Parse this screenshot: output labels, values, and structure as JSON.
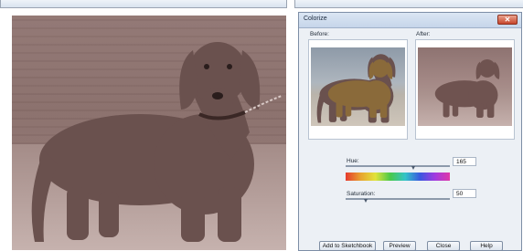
{
  "dialog": {
    "title": "Colorize",
    "close_symbol": "✕",
    "before_label": "Before:",
    "after_label": "After:",
    "hue": {
      "label": "Hue:",
      "value": "165",
      "level": 0.65
    },
    "saturation": {
      "label": "Saturation:",
      "value": "50",
      "level": 0.2
    },
    "buttons": {
      "add_to_sketchbook": "Add to Sketchbook",
      "preview": "Preview",
      "close": "Close",
      "help": "Help"
    }
  },
  "colors": {
    "before_dog": "#8a6a3a",
    "tinted_dog": "#6f5350",
    "photo_dog": "#6a514e"
  },
  "icons": {
    "close": "close-icon"
  }
}
